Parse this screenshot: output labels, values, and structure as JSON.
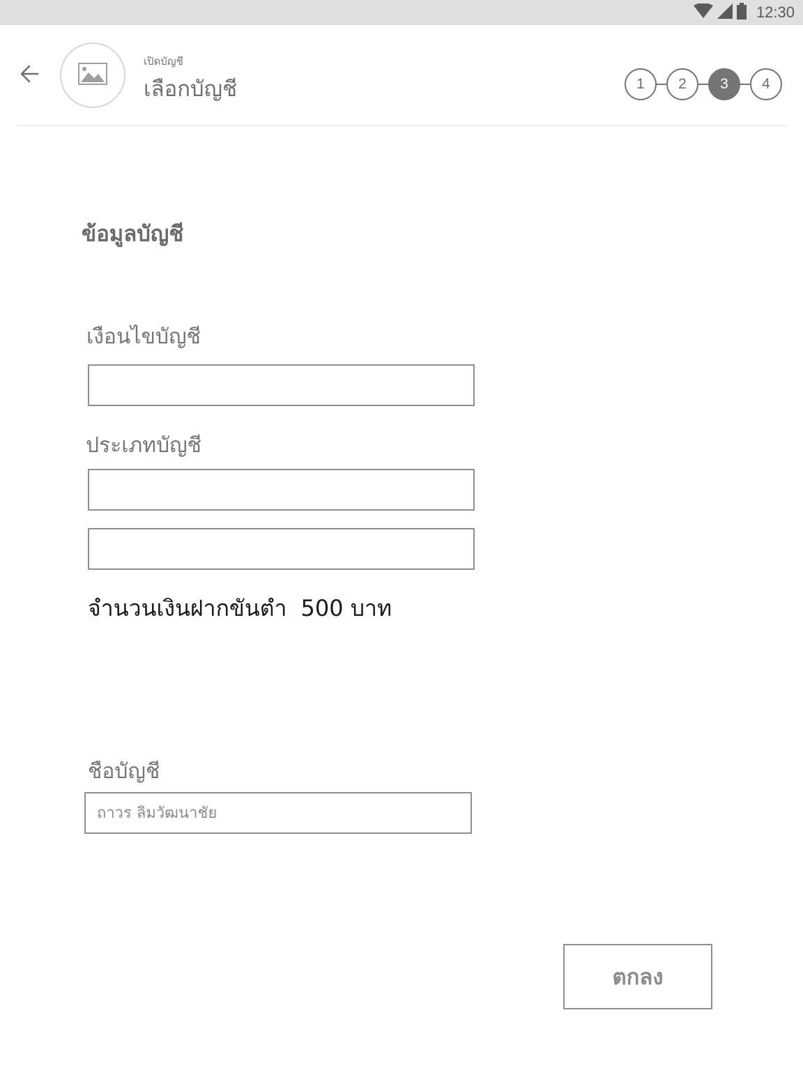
{
  "status_bar": {
    "time": "12:30",
    "icons": [
      "wifi-icon",
      "signal-icon",
      "battery-icon"
    ]
  },
  "header": {
    "back_icon": "arrow-left-icon",
    "avatar_icon": "image-placeholder-icon",
    "subtitle": "เปิดบัญชี",
    "title": "เลือกบัญชี",
    "steps": [
      {
        "label": "1",
        "active": false
      },
      {
        "label": "2",
        "active": false
      },
      {
        "label": "3",
        "active": true
      },
      {
        "label": "4",
        "active": false
      }
    ]
  },
  "form": {
    "section_title": "ข้อมูลบัญชี",
    "condition_label": "เงือนไขบัญชี",
    "condition_value": "",
    "account_type_label": "ประเภทบัญชี",
    "account_type_value_1": "",
    "account_type_value_2": "",
    "min_deposit_label": "จำนวนเงินฝากขันตำ",
    "min_deposit_amount": "500 บาท",
    "account_name_label": "ชือบัญชี",
    "account_name_placeholder": "ถาวร ลิมวัฒนาชัย",
    "account_name_value": "",
    "ok_button_label": "ตกลง"
  },
  "colors": {
    "status_bar_bg": "#e0e0e0",
    "active_step": "#757575",
    "text_primary": "#757575",
    "text_dark": "#1a1a1a",
    "border": "#8f8f8f"
  }
}
